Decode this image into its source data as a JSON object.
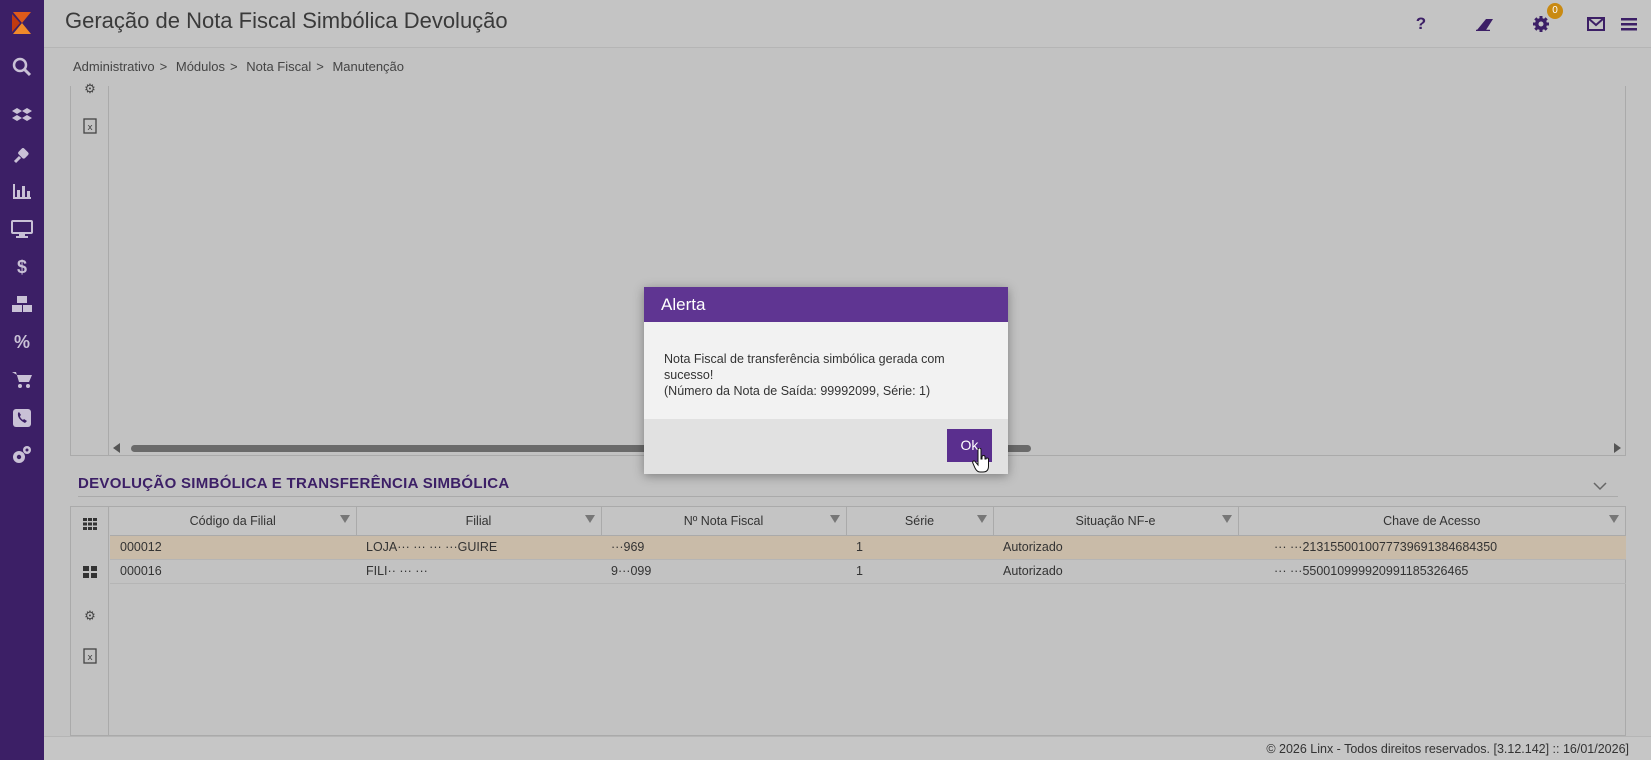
{
  "header": {
    "title": "Geração de Nota Fiscal Simbólica Devolução",
    "help_icon": "question-icon",
    "eraser_icon": "eraser-icon",
    "settings_icon": "gear-icon",
    "mail_icon": "mail-icon",
    "mail_badge": "0",
    "menu_icon": "hamburger-icon"
  },
  "breadcrumb": [
    "Administrativo",
    "Módulos",
    "Nota Fiscal",
    "Manutenção"
  ],
  "breadcrumb_sep": ">",
  "sidebar": {
    "icons": [
      "search-icon",
      "dropbox-icon",
      "plug-icon",
      "bar-chart-icon",
      "monitor-icon",
      "dollar-icon",
      "boxes-icon",
      "percent-icon",
      "cart-icon",
      "phone-icon",
      "gears-icon"
    ]
  },
  "section": {
    "title": "DEVOLUÇÃO SIMBÓLICA E TRANSFERÊNCIA SIMBÓLICA"
  },
  "grid": {
    "columns": [
      "Código da Filial",
      "Filial",
      "Nº Nota Fiscal",
      "Série",
      "Situação NF-e",
      "Chave de Acesso"
    ],
    "rows": [
      {
        "codigo": "000012",
        "filial": "LOJA··· ··· ··· ···GUIRE",
        "nota": "···969",
        "serie": "1",
        "situacao": "Autorizado",
        "chave": "··· ···2131550010077739691384684350"
      },
      {
        "codigo": "000016",
        "filial": "FILI·· ··· ···",
        "nota": "9···099",
        "serie": "1",
        "situacao": "Autorizado",
        "chave": "··· ···5500109999209911853264​65"
      }
    ]
  },
  "modal": {
    "title": "Alerta",
    "line1": "Nota Fiscal de transferência simbólica gerada com sucesso!",
    "line2": "(Número da Nota de Saída: 99992099, Série: 1)",
    "ok_label": "Ok"
  },
  "footer": {
    "text": "© 2026 Linx - Todos direitos reservados. [3.12.142] :: 16/01/2026]"
  },
  "colors": {
    "sidebar": "#3c1f66",
    "accent": "#5f3592"
  }
}
